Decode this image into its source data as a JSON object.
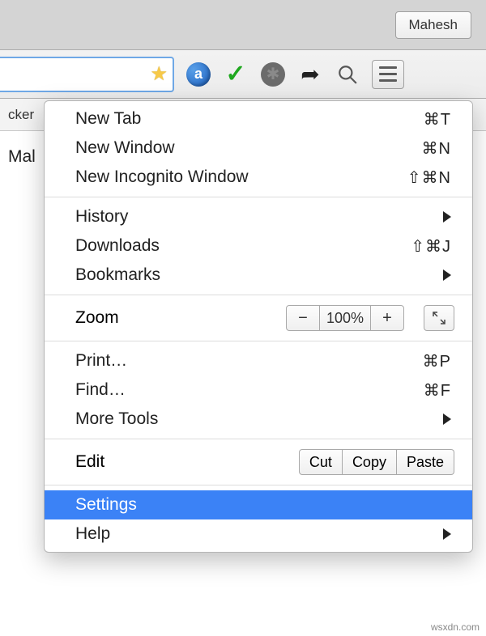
{
  "titlebar": {
    "profile": "Mahesh"
  },
  "toolbar": {
    "icons": {
      "star": "star-icon",
      "a": "a",
      "check": "✓",
      "share": "➦"
    }
  },
  "bookmarkbar": {
    "item0": "cker"
  },
  "page": {
    "text_fragment": "Mal"
  },
  "menu": {
    "new_tab": "New Tab",
    "new_tab_sc": "⌘T",
    "new_window": "New Window",
    "new_window_sc": "⌘N",
    "new_incognito": "New Incognito Window",
    "new_incognito_sc": "⇧⌘N",
    "history": "History",
    "downloads": "Downloads",
    "downloads_sc": "⇧⌘J",
    "bookmarks": "Bookmarks",
    "zoom": "Zoom",
    "zoom_value": "100%",
    "print": "Print…",
    "print_sc": "⌘P",
    "find": "Find…",
    "find_sc": "⌘F",
    "more_tools": "More Tools",
    "edit": "Edit",
    "cut": "Cut",
    "copy": "Copy",
    "paste": "Paste",
    "settings": "Settings",
    "help": "Help"
  },
  "watermark": "wsxdn.com"
}
